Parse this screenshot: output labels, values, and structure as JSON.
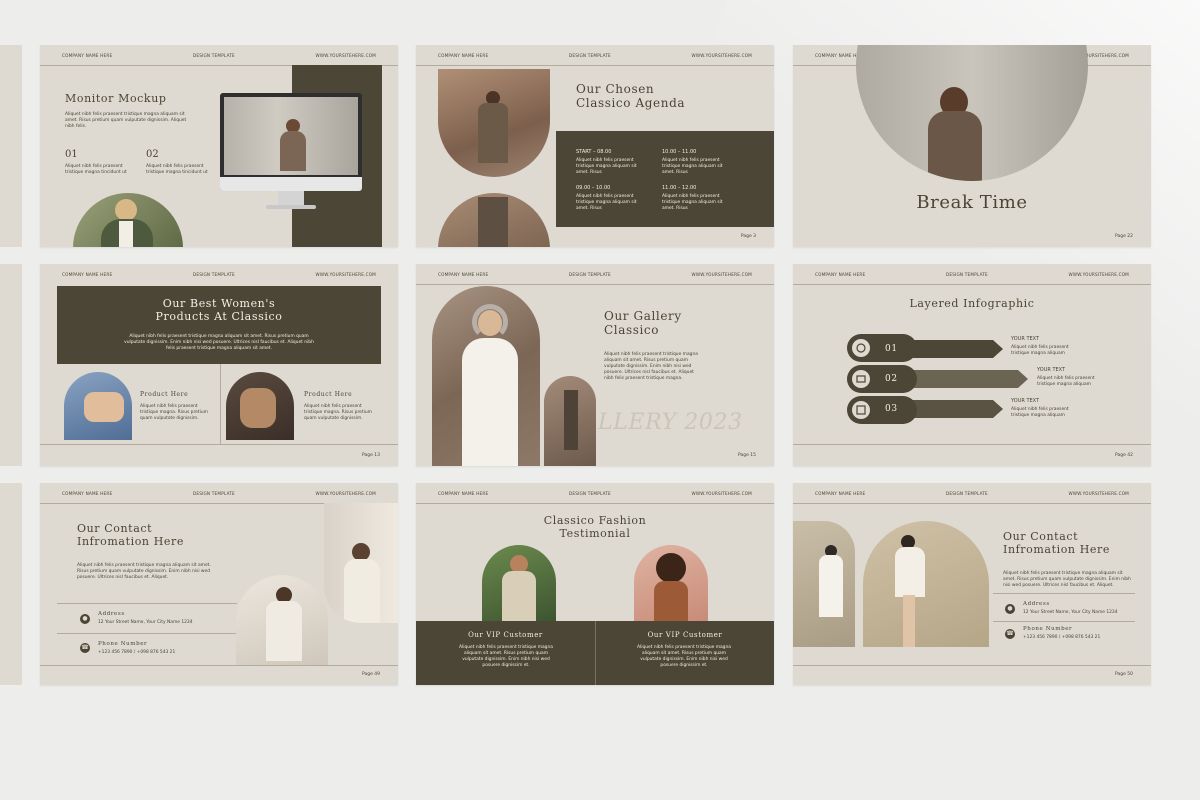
{
  "header": {
    "company": "COMPANY NAME HERE",
    "template": "DESIGN TEMPLATE",
    "site": "WWW.YOURSITEHERE.COM"
  },
  "lorem_short": "Aliquet nibh felis praesent tristique magna tincidunt. Sem",
  "lorem_long": "Aliquet nibh felis praesent tristique magna aliquam sit amet. Risus pretium quam vulputate dignissim. Enim nibh nisi wed posuere. Ultrices nisl faucibus et. Sit amet sed.",
  "slides": {
    "monitor": {
      "title": "Monitor Mockup",
      "para": "Aliquet nibh felis praesent tristique magna aliquam sit amet. Risus pretium quam vulputate dignissim. Aliquet nibh felis.",
      "n1": "01",
      "n2": "02",
      "t1": "Aliquet nibh felis praesent tristique magna tincidunt ut",
      "t2": "Aliquet nibh felis praesent tristique magna tincidunt ut"
    },
    "agenda": {
      "title1": "Our Chosen",
      "title2": "Classico Agenda",
      "items": [
        {
          "time": "START – 08.00",
          "text": "Aliquet nibh felis praesent tristique magna aliquam sit amet. Risus"
        },
        {
          "time": "10.00 – 11.00",
          "text": "Aliquet nibh felis praesent tristique magna aliquam sit amet. Risus"
        },
        {
          "time": "09.00 – 10.00",
          "text": "Aliquet nibh felis praesent tristique magna aliquam sit amet. Risus"
        },
        {
          "time": "11.00 – 12.00",
          "text": "Aliquet nibh felis praesent tristique magna aliquam sit amet. Risus"
        }
      ],
      "page": "Page 3"
    },
    "break": {
      "title": "Break Time",
      "page": "Page 22"
    },
    "products": {
      "title1": "Our Best Women's",
      "title2": "Products At Classico",
      "para": "Aliquet nibh felis praesent tristique magna aliquam sit amet. Risus pretium quam vulputate dignissim. Enim nibh nisi wed posuere. Ultrices nisl faucibus et. Aliquet nibh felis praesent tristique magna aliquam sit amet.",
      "p1": "Product Here",
      "p2": "Product Here",
      "ptext": "Aliquet nibh felis praesent tristique magna. Risus pretium quam vulputate dignissim.",
      "page": "Page 13"
    },
    "gallery": {
      "title1": "Our Gallery",
      "title2": "Classico",
      "para": "Aliquet nibh felis praesent tristique magna aliquam sit amet. Risus pretium quam vulputate dignissim. Enim nibh nisi wed posuere. Ultrices nisl faucibus et. Aliquet nibh felis praesent tristique magna.",
      "watermark": "LLERY 2023",
      "page": "Page 15"
    },
    "infographic": {
      "title": "Layered Infographic",
      "items": [
        {
          "n": "01",
          "label": "YOUR TEXT",
          "text": "Aliquet nibh felis praesent tristique magna aliquam"
        },
        {
          "n": "02",
          "label": "YOUR TEXT",
          "text": "Aliquet nibh felis praesent tristique magna aliquam"
        },
        {
          "n": "03",
          "label": "YOUR TEXT",
          "text": "Aliquet nibh felis praesent tristique magna aliquam"
        }
      ],
      "page": "Page 42"
    },
    "contact1": {
      "title1": "Our Contact",
      "title2": "Infromation Here",
      "para": "Aliquet nibh felis praesent tristique magna aliquam sit amet. Risus pretium quam vulputate dignissim. Enim nibh nisi wed posuere. Ultrices nisl faucibus et. Aliquet.",
      "addr_label": "Address",
      "addr": "12 Your Street Name, Your City Name 1234",
      "phone_label": "Phone Number",
      "phone": "+123 456 7890 / +098 876 543 21",
      "page": "Page 49"
    },
    "testimonial": {
      "title1": "Classico Fashion",
      "title2": "Testimonial",
      "c1": "Our VIP Customer",
      "c2": "Our VIP Customer",
      "ctext": "Aliquet nibh felis praesent tristique magna aliquam sit amet. Risus pretium quam vulputate dignissim. Enim nibh nisi wed posuere dignissim et."
    },
    "contact2": {
      "title1": "Our Contact",
      "title2": "Infromation Here",
      "para": "Aliquet nibh felis praesent tristique magna aliquam sit amet. Risus pretium quam vulputate dignissim. Enim nibh nisi wed posuere. Ultrices nisl faucibus et. Aliquet.",
      "addr_label": "Address",
      "addr": "12 Your Street Name, Your City Name 1234",
      "phone_label": "Phone Number",
      "phone": "+123 456 7890 / +098 876 543 21",
      "page": "Page 50"
    }
  },
  "colors": {
    "dark": "#4c4636",
    "slide": "#dedad1",
    "background": "#ededec"
  }
}
